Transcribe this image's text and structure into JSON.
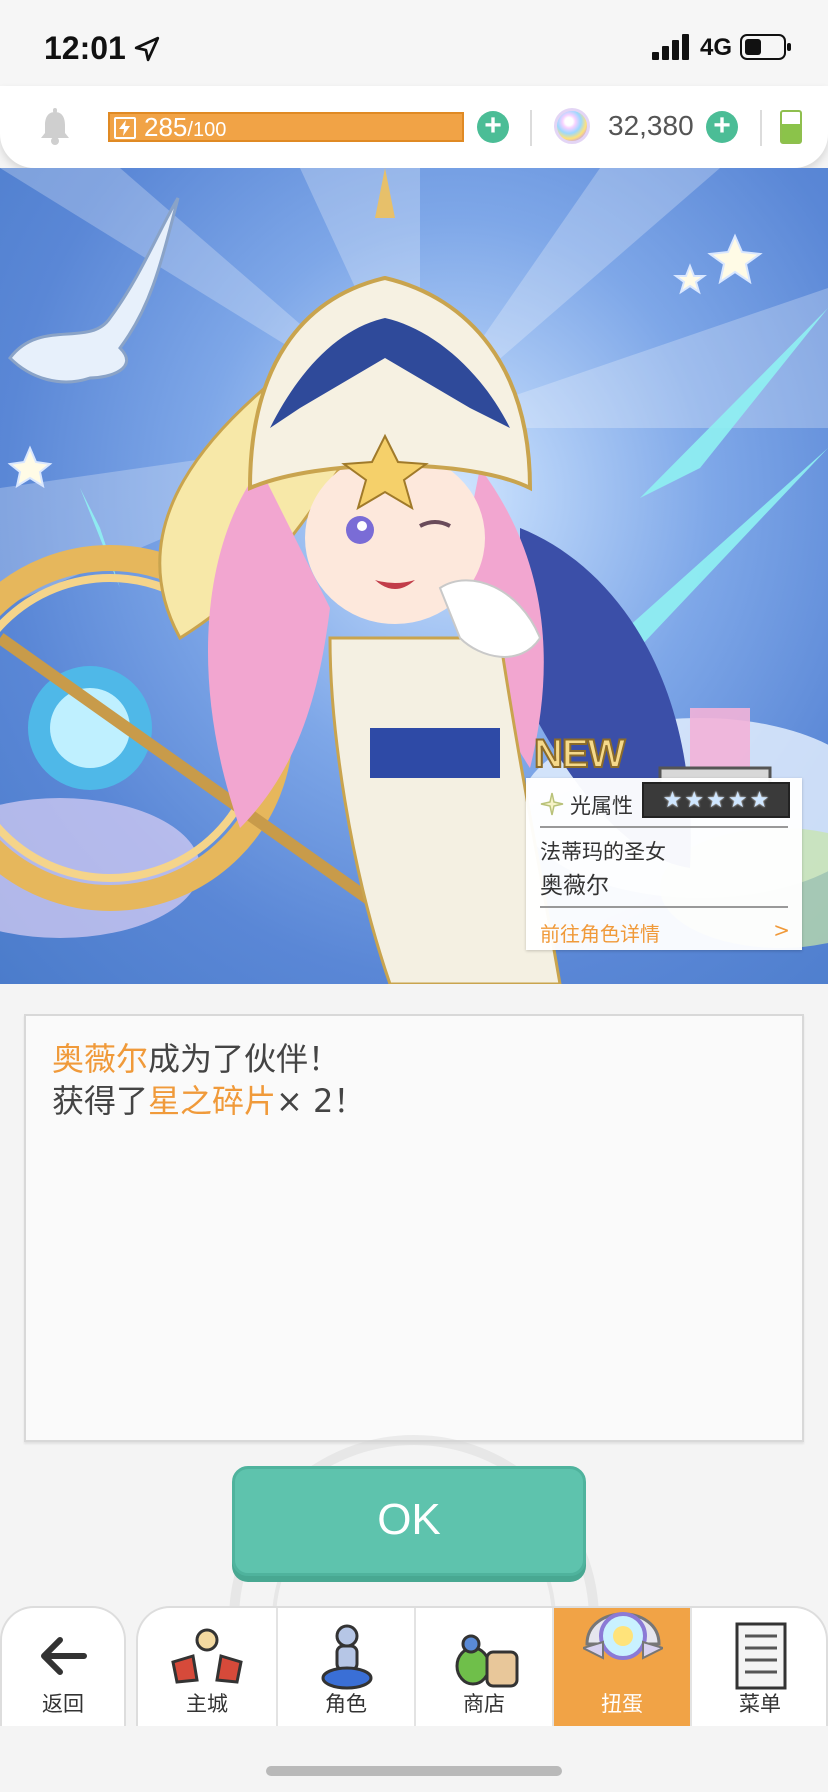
{
  "status_bar": {
    "time": "12:01",
    "network": "4G"
  },
  "resources": {
    "stamina_current": "285",
    "stamina_max": "/100",
    "gems": "32,380"
  },
  "character_card": {
    "new_badge": "NEW",
    "attribute": "光属性",
    "stars": 5,
    "title": "法蒂玛的圣女",
    "name": "奥薇尔",
    "detail_link": "前往角色详情",
    "detail_arrow": ">"
  },
  "message": {
    "line1_highlight": "奥薇尔",
    "line1_rest": "成为了伙伴！",
    "line2_prefix": "获得了",
    "line2_highlight": "星之碎片",
    "line2_suffix": "× 2！"
  },
  "ok_button": {
    "label": "OK"
  },
  "bottom_nav": {
    "back_label": "返回",
    "items": [
      {
        "label": "主城",
        "icon": "castle-icon"
      },
      {
        "label": "角色",
        "icon": "character-icon"
      },
      {
        "label": "商店",
        "icon": "shop-icon"
      },
      {
        "label": "扭蛋",
        "icon": "gacha-icon",
        "active": true
      },
      {
        "label": "菜单",
        "icon": "menu-icon"
      }
    ]
  },
  "colors": {
    "accent_orange": "#f1a346",
    "highlight_text": "#f09a3a",
    "ok_green": "#5ec3ad",
    "plus_green": "#4bbd96"
  }
}
